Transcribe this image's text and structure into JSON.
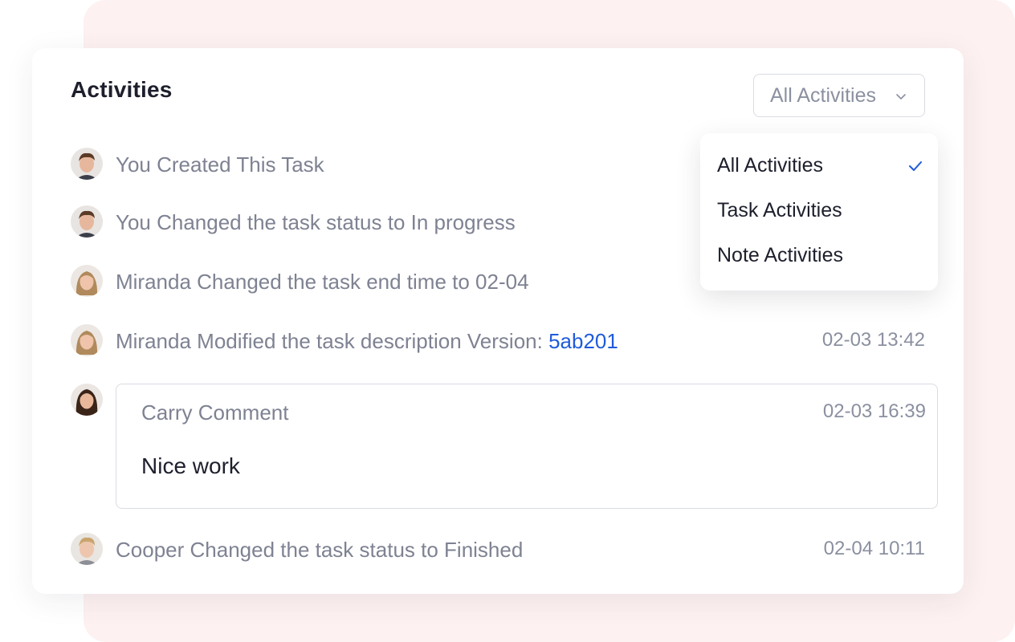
{
  "panel": {
    "title": "Activities",
    "filter": {
      "selected": "All Activities"
    }
  },
  "dropdown": {
    "options": [
      {
        "label": "All Activities",
        "checked": true
      },
      {
        "label": "Task Activities",
        "checked": false
      },
      {
        "label": "Note Activities",
        "checked": false
      }
    ]
  },
  "activities": [
    {
      "avatar": "man-avatar",
      "text": "You Created This Task",
      "time": ""
    },
    {
      "avatar": "man-avatar",
      "text": "You Changed the task status to In progress",
      "time": ""
    },
    {
      "avatar": "woman-avatar",
      "text": "Miranda Changed the task end time to 02-04",
      "time": ""
    },
    {
      "avatar": "woman-avatar",
      "text": "Miranda Modified the task description Version: ",
      "link": "5ab201",
      "time": "02-03 13:42"
    },
    {
      "avatar": "woman-dark-avatar",
      "comment": {
        "author": "Carry Comment",
        "time": "02-03 16:39",
        "body": "Nice work"
      }
    },
    {
      "avatar": "blond-man-avatar",
      "text": "Cooper Changed the task status to Finished",
      "time": "02-04 10:11"
    }
  ],
  "colors": {
    "accent": "#1f5bdc",
    "muted_text": "#7e8292",
    "backdrop": "#fdf1f1"
  }
}
